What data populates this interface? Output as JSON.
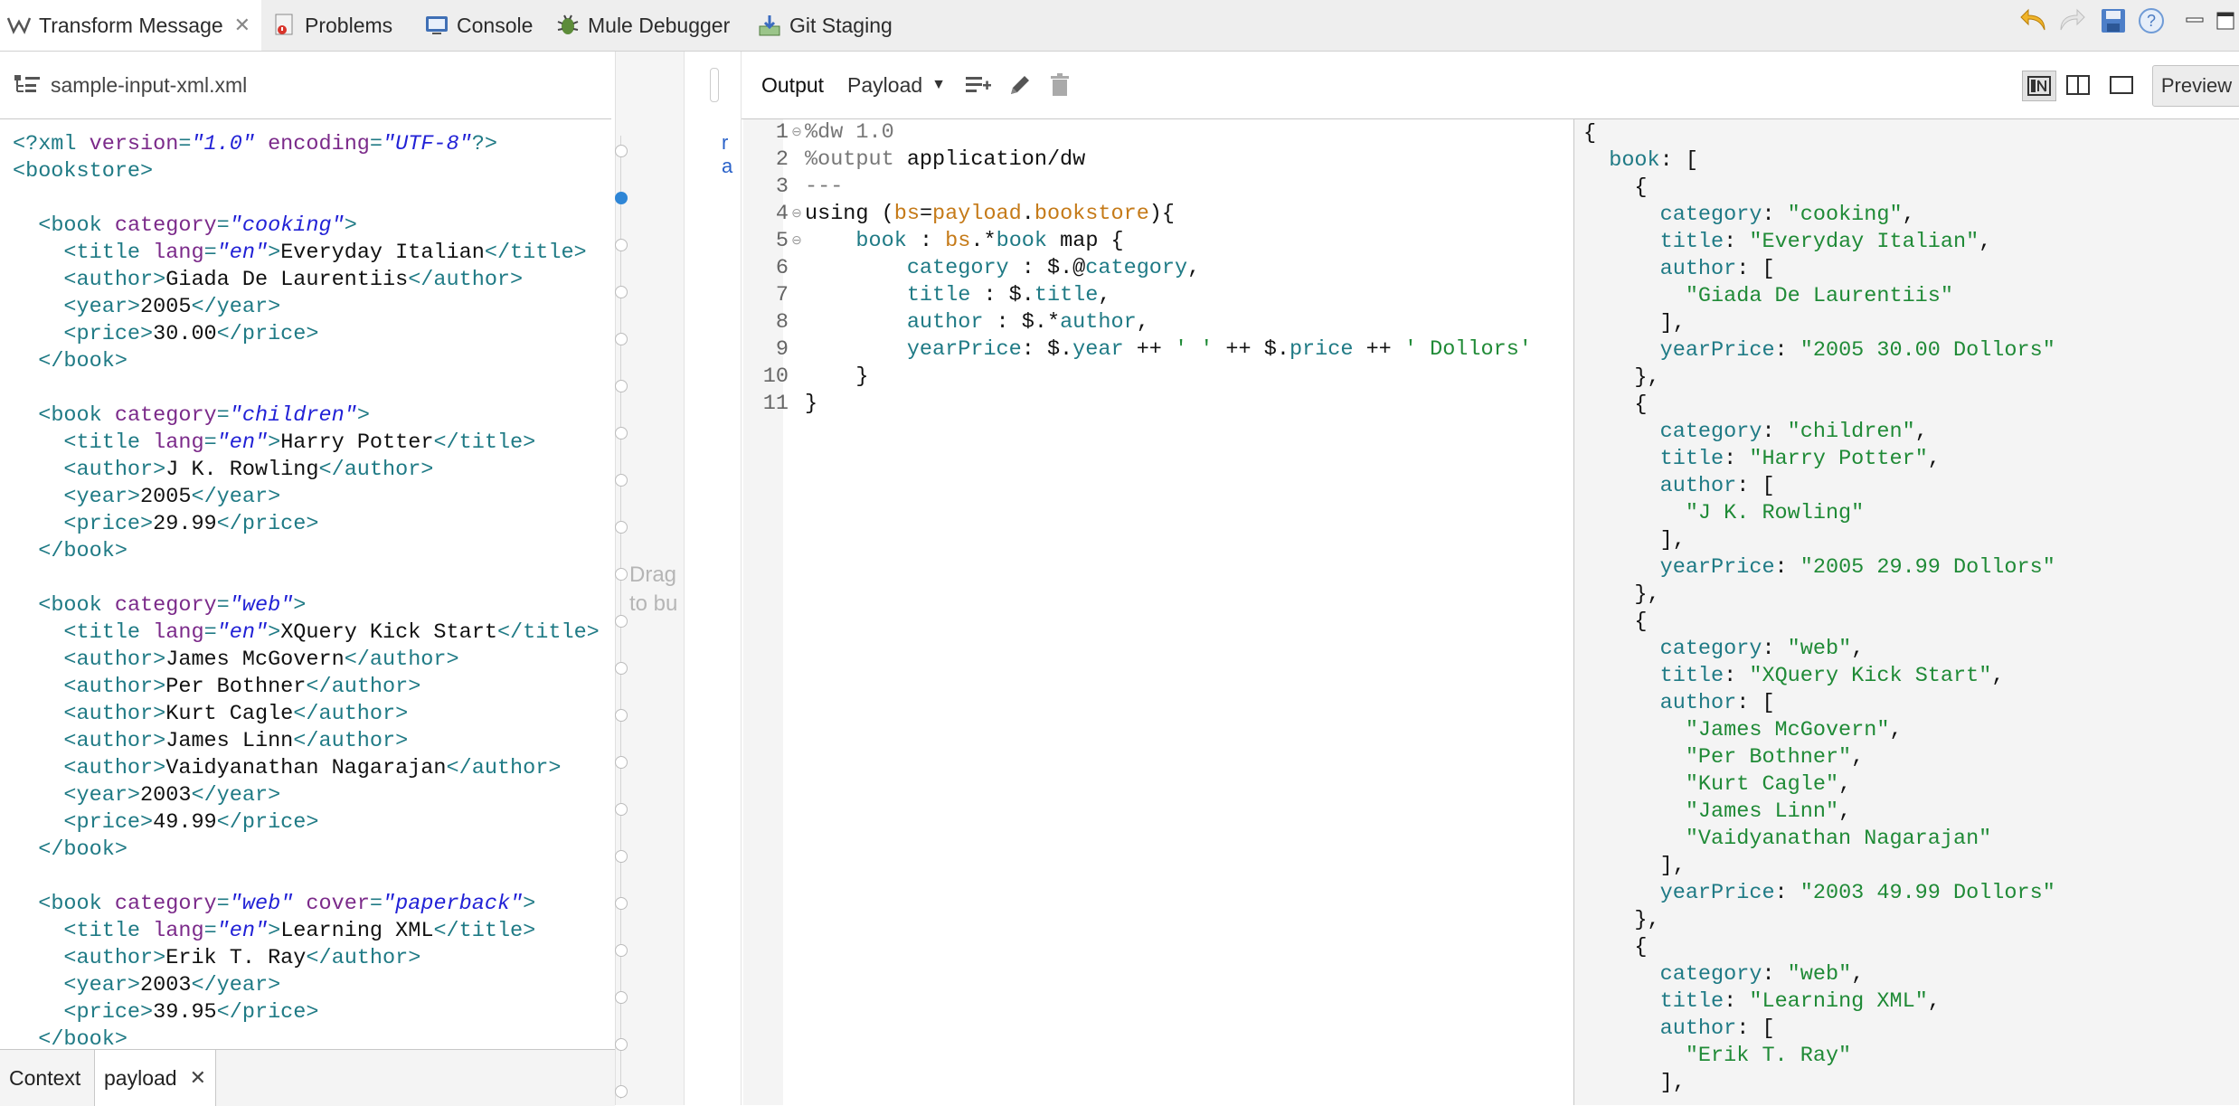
{
  "tabs": [
    {
      "label": "Transform Message",
      "icon": "transform-icon",
      "active": true
    },
    {
      "label": "Problems",
      "icon": "problems-icon"
    },
    {
      "label": "Console",
      "icon": "console-icon"
    },
    {
      "label": "Mule Debugger",
      "icon": "debugger-icon"
    },
    {
      "label": "Git Staging",
      "icon": "git-staging-icon"
    }
  ],
  "toolbar_icons": [
    "undo-icon",
    "redo-icon",
    "save-icon",
    "help-icon",
    "minimize-icon",
    "maximize-icon"
  ],
  "input": {
    "filename": "sample-input-xml.xml",
    "bottom_tabs": {
      "context": "Context",
      "payload": "payload"
    }
  },
  "mapping": {
    "drag_hint_line1": "Drag",
    "drag_hint_line2": "to bu"
  },
  "output": {
    "label": "Output",
    "target": "Payload",
    "preview_label": "Preview"
  },
  "xml_lines": [
    [
      [
        "t",
        "<?xml "
      ],
      [
        "a",
        "version"
      ],
      [
        "t",
        "="
      ],
      [
        "v",
        "\"1.0\""
      ],
      [
        "t",
        " "
      ],
      [
        "a",
        "encoding"
      ],
      [
        "t",
        "="
      ],
      [
        "v",
        "\"UTF-8\""
      ],
      [
        "t",
        "?>"
      ]
    ],
    [
      [
        "t",
        "<bookstore>"
      ]
    ],
    [],
    [
      [
        "x",
        "  "
      ],
      [
        "t",
        "<book "
      ],
      [
        "a",
        "category"
      ],
      [
        "t",
        "="
      ],
      [
        "v",
        "\"cooking\""
      ],
      [
        "t",
        ">"
      ]
    ],
    [
      [
        "x",
        "    "
      ],
      [
        "t",
        "<title "
      ],
      [
        "a",
        "lang"
      ],
      [
        "t",
        "="
      ],
      [
        "v",
        "\"en\""
      ],
      [
        "t",
        ">"
      ],
      [
        "x",
        "Everyday Italian"
      ],
      [
        "t",
        "</title>"
      ]
    ],
    [
      [
        "x",
        "    "
      ],
      [
        "t",
        "<author>"
      ],
      [
        "x",
        "Giada De Laurentiis"
      ],
      [
        "t",
        "</author>"
      ]
    ],
    [
      [
        "x",
        "    "
      ],
      [
        "t",
        "<year>"
      ],
      [
        "x",
        "2005"
      ],
      [
        "t",
        "</year>"
      ]
    ],
    [
      [
        "x",
        "    "
      ],
      [
        "t",
        "<price>"
      ],
      [
        "x",
        "30.00"
      ],
      [
        "t",
        "</price>"
      ]
    ],
    [
      [
        "x",
        "  "
      ],
      [
        "t",
        "</book>"
      ]
    ],
    [],
    [
      [
        "x",
        "  "
      ],
      [
        "t",
        "<book "
      ],
      [
        "a",
        "category"
      ],
      [
        "t",
        "="
      ],
      [
        "v",
        "\"children\""
      ],
      [
        "t",
        ">"
      ]
    ],
    [
      [
        "x",
        "    "
      ],
      [
        "t",
        "<title "
      ],
      [
        "a",
        "lang"
      ],
      [
        "t",
        "="
      ],
      [
        "v",
        "\"en\""
      ],
      [
        "t",
        ">"
      ],
      [
        "x",
        "Harry Potter"
      ],
      [
        "t",
        "</title>"
      ]
    ],
    [
      [
        "x",
        "    "
      ],
      [
        "t",
        "<author>"
      ],
      [
        "x",
        "J K. Rowling"
      ],
      [
        "t",
        "</author>"
      ]
    ],
    [
      [
        "x",
        "    "
      ],
      [
        "t",
        "<year>"
      ],
      [
        "x",
        "2005"
      ],
      [
        "t",
        "</year>"
      ]
    ],
    [
      [
        "x",
        "    "
      ],
      [
        "t",
        "<price>"
      ],
      [
        "x",
        "29.99"
      ],
      [
        "t",
        "</price>"
      ]
    ],
    [
      [
        "x",
        "  "
      ],
      [
        "t",
        "</book>"
      ]
    ],
    [],
    [
      [
        "x",
        "  "
      ],
      [
        "t",
        "<book "
      ],
      [
        "a",
        "category"
      ],
      [
        "t",
        "="
      ],
      [
        "v",
        "\"web\""
      ],
      [
        "t",
        ">"
      ]
    ],
    [
      [
        "x",
        "    "
      ],
      [
        "t",
        "<title "
      ],
      [
        "a",
        "lang"
      ],
      [
        "t",
        "="
      ],
      [
        "v",
        "\"en\""
      ],
      [
        "t",
        ">"
      ],
      [
        "x",
        "XQuery Kick Start"
      ],
      [
        "t",
        "</title>"
      ]
    ],
    [
      [
        "x",
        "    "
      ],
      [
        "t",
        "<author>"
      ],
      [
        "x",
        "James McGovern"
      ],
      [
        "t",
        "</author>"
      ]
    ],
    [
      [
        "x",
        "    "
      ],
      [
        "t",
        "<author>"
      ],
      [
        "x",
        "Per Bothner"
      ],
      [
        "t",
        "</author>"
      ]
    ],
    [
      [
        "x",
        "    "
      ],
      [
        "t",
        "<author>"
      ],
      [
        "x",
        "Kurt Cagle"
      ],
      [
        "t",
        "</author>"
      ]
    ],
    [
      [
        "x",
        "    "
      ],
      [
        "t",
        "<author>"
      ],
      [
        "x",
        "James Linn"
      ],
      [
        "t",
        "</author>"
      ]
    ],
    [
      [
        "x",
        "    "
      ],
      [
        "t",
        "<author>"
      ],
      [
        "x",
        "Vaidyanathan Nagarajan"
      ],
      [
        "t",
        "</author>"
      ]
    ],
    [
      [
        "x",
        "    "
      ],
      [
        "t",
        "<year>"
      ],
      [
        "x",
        "2003"
      ],
      [
        "t",
        "</year>"
      ]
    ],
    [
      [
        "x",
        "    "
      ],
      [
        "t",
        "<price>"
      ],
      [
        "x",
        "49.99"
      ],
      [
        "t",
        "</price>"
      ]
    ],
    [
      [
        "x",
        "  "
      ],
      [
        "t",
        "</book>"
      ]
    ],
    [],
    [
      [
        "x",
        "  "
      ],
      [
        "t",
        "<book "
      ],
      [
        "a",
        "category"
      ],
      [
        "t",
        "="
      ],
      [
        "v",
        "\"web\""
      ],
      [
        "t",
        " "
      ],
      [
        "a",
        "cover"
      ],
      [
        "t",
        "="
      ],
      [
        "v",
        "\"paperback\""
      ],
      [
        "t",
        ">"
      ]
    ],
    [
      [
        "x",
        "    "
      ],
      [
        "t",
        "<title "
      ],
      [
        "a",
        "lang"
      ],
      [
        "t",
        "="
      ],
      [
        "v",
        "\"en\""
      ],
      [
        "t",
        ">"
      ],
      [
        "x",
        "Learning XML"
      ],
      [
        "t",
        "</title>"
      ]
    ],
    [
      [
        "x",
        "    "
      ],
      [
        "t",
        "<author>"
      ],
      [
        "x",
        "Erik T. Ray"
      ],
      [
        "t",
        "</author>"
      ]
    ],
    [
      [
        "x",
        "    "
      ],
      [
        "t",
        "<year>"
      ],
      [
        "x",
        "2003"
      ],
      [
        "t",
        "</year>"
      ]
    ],
    [
      [
        "x",
        "    "
      ],
      [
        "t",
        "<price>"
      ],
      [
        "x",
        "39.95"
      ],
      [
        "t",
        "</price>"
      ]
    ],
    [
      [
        "x",
        "  "
      ],
      [
        "t",
        "</book>"
      ]
    ]
  ],
  "code_lines": [
    {
      "n": "1",
      "fold": true,
      "parts": [
        [
          "d",
          "%dw 1.0"
        ]
      ]
    },
    {
      "n": "2",
      "parts": [
        [
          "d",
          "%output"
        ],
        [
          "p",
          " application/dw"
        ]
      ]
    },
    {
      "n": "3",
      "parts": [
        [
          "d",
          "---"
        ]
      ]
    },
    {
      "n": "4",
      "fold": true,
      "parts": [
        [
          "p",
          "using ("
        ],
        [
          "o",
          "bs"
        ],
        [
          "p",
          "="
        ],
        [
          "o",
          "payload"
        ],
        [
          "p",
          "."
        ],
        [
          "o",
          "bookstore"
        ],
        [
          "p",
          "){"
        ]
      ]
    },
    {
      "n": "5",
      "fold": true,
      "parts": [
        [
          "p",
          "    "
        ],
        [
          "k",
          "book"
        ],
        [
          "p",
          " : "
        ],
        [
          "o",
          "bs"
        ],
        [
          "p",
          ".*"
        ],
        [
          "k",
          "book"
        ],
        [
          "p",
          " map {"
        ]
      ]
    },
    {
      "n": "6",
      "parts": [
        [
          "p",
          "        "
        ],
        [
          "k",
          "category"
        ],
        [
          "p",
          " : $.@"
        ],
        [
          "k",
          "category"
        ],
        [
          "p",
          ","
        ]
      ]
    },
    {
      "n": "7",
      "parts": [
        [
          "p",
          "        "
        ],
        [
          "k",
          "title"
        ],
        [
          "p",
          " : $."
        ],
        [
          "k",
          "title"
        ],
        [
          "p",
          ","
        ]
      ]
    },
    {
      "n": "8",
      "parts": [
        [
          "p",
          "        "
        ],
        [
          "k",
          "author"
        ],
        [
          "p",
          " : $.*"
        ],
        [
          "k",
          "author"
        ],
        [
          "p",
          ","
        ]
      ]
    },
    {
      "n": "9",
      "parts": [
        [
          "p",
          "        "
        ],
        [
          "k",
          "yearPrice"
        ],
        [
          "p",
          ": $."
        ],
        [
          "k",
          "year"
        ],
        [
          "p",
          " ++ "
        ],
        [
          "s",
          "' '"
        ],
        [
          "p",
          " ++ $."
        ],
        [
          "k",
          "price"
        ],
        [
          "p",
          " ++ "
        ],
        [
          "s",
          "' Dollors'"
        ]
      ]
    },
    {
      "n": "10",
      "parts": [
        [
          "p",
          "    }"
        ]
      ]
    },
    {
      "n": "11",
      "parts": [
        [
          "p",
          "}"
        ]
      ]
    }
  ],
  "json_lines": [
    [
      [
        "p",
        "{"
      ]
    ],
    [
      [
        "p",
        "  "
      ],
      [
        "k",
        "book"
      ],
      [
        "p",
        ": ["
      ]
    ],
    [
      [
        "p",
        "    {"
      ]
    ],
    [
      [
        "p",
        "      "
      ],
      [
        "k",
        "category"
      ],
      [
        "p",
        ": "
      ],
      [
        "s",
        "\"cooking\""
      ],
      [
        "p",
        ","
      ]
    ],
    [
      [
        "p",
        "      "
      ],
      [
        "k",
        "title"
      ],
      [
        "p",
        ": "
      ],
      [
        "s",
        "\"Everyday Italian\""
      ],
      [
        "p",
        ","
      ]
    ],
    [
      [
        "p",
        "      "
      ],
      [
        "k",
        "author"
      ],
      [
        "p",
        ": ["
      ]
    ],
    [
      [
        "p",
        "        "
      ],
      [
        "s",
        "\"Giada De Laurentiis\""
      ]
    ],
    [
      [
        "p",
        "      ],"
      ]
    ],
    [
      [
        "p",
        "      "
      ],
      [
        "k",
        "yearPrice"
      ],
      [
        "p",
        ": "
      ],
      [
        "s",
        "\"2005 30.00 Dollors\""
      ]
    ],
    [
      [
        "p",
        "    },"
      ]
    ],
    [
      [
        "p",
        "    {"
      ]
    ],
    [
      [
        "p",
        "      "
      ],
      [
        "k",
        "category"
      ],
      [
        "p",
        ": "
      ],
      [
        "s",
        "\"children\""
      ],
      [
        "p",
        ","
      ]
    ],
    [
      [
        "p",
        "      "
      ],
      [
        "k",
        "title"
      ],
      [
        "p",
        ": "
      ],
      [
        "s",
        "\"Harry Potter\""
      ],
      [
        "p",
        ","
      ]
    ],
    [
      [
        "p",
        "      "
      ],
      [
        "k",
        "author"
      ],
      [
        "p",
        ": ["
      ]
    ],
    [
      [
        "p",
        "        "
      ],
      [
        "s",
        "\"J K. Rowling\""
      ]
    ],
    [
      [
        "p",
        "      ],"
      ]
    ],
    [
      [
        "p",
        "      "
      ],
      [
        "k",
        "yearPrice"
      ],
      [
        "p",
        ": "
      ],
      [
        "s",
        "\"2005 29.99 Dollors\""
      ]
    ],
    [
      [
        "p",
        "    },"
      ]
    ],
    [
      [
        "p",
        "    {"
      ]
    ],
    [
      [
        "p",
        "      "
      ],
      [
        "k",
        "category"
      ],
      [
        "p",
        ": "
      ],
      [
        "s",
        "\"web\""
      ],
      [
        "p",
        ","
      ]
    ],
    [
      [
        "p",
        "      "
      ],
      [
        "k",
        "title"
      ],
      [
        "p",
        ": "
      ],
      [
        "s",
        "\"XQuery Kick Start\""
      ],
      [
        "p",
        ","
      ]
    ],
    [
      [
        "p",
        "      "
      ],
      [
        "k",
        "author"
      ],
      [
        "p",
        ": ["
      ]
    ],
    [
      [
        "p",
        "        "
      ],
      [
        "s",
        "\"James McGovern\""
      ],
      [
        "p",
        ","
      ]
    ],
    [
      [
        "p",
        "        "
      ],
      [
        "s",
        "\"Per Bothner\""
      ],
      [
        "p",
        ","
      ]
    ],
    [
      [
        "p",
        "        "
      ],
      [
        "s",
        "\"Kurt Cagle\""
      ],
      [
        "p",
        ","
      ]
    ],
    [
      [
        "p",
        "        "
      ],
      [
        "s",
        "\"James Linn\""
      ],
      [
        "p",
        ","
      ]
    ],
    [
      [
        "p",
        "        "
      ],
      [
        "s",
        "\"Vaidyanathan Nagarajan\""
      ]
    ],
    [
      [
        "p",
        "      ],"
      ]
    ],
    [
      [
        "p",
        "      "
      ],
      [
        "k",
        "yearPrice"
      ],
      [
        "p",
        ": "
      ],
      [
        "s",
        "\"2003 49.99 Dollors\""
      ]
    ],
    [
      [
        "p",
        "    },"
      ]
    ],
    [
      [
        "p",
        "    {"
      ]
    ],
    [
      [
        "p",
        "      "
      ],
      [
        "k",
        "category"
      ],
      [
        "p",
        ": "
      ],
      [
        "s",
        "\"web\""
      ],
      [
        "p",
        ","
      ]
    ],
    [
      [
        "p",
        "      "
      ],
      [
        "k",
        "title"
      ],
      [
        "p",
        ": "
      ],
      [
        "s",
        "\"Learning XML\""
      ],
      [
        "p",
        ","
      ]
    ],
    [
      [
        "p",
        "      "
      ],
      [
        "k",
        "author"
      ],
      [
        "p",
        ": ["
      ]
    ],
    [
      [
        "p",
        "        "
      ],
      [
        "s",
        "\"Erik T. Ray\""
      ]
    ],
    [
      [
        "p",
        "      ],"
      ]
    ]
  ],
  "colors": {
    "xml_tag": "#1f7a85",
    "xml_attr": "#7b2a8a",
    "xml_value": "#2121d6",
    "keyword": "#1f7a85",
    "variable": "#c57a18",
    "string": "#1f8a36",
    "accent": "#2f86d6"
  }
}
